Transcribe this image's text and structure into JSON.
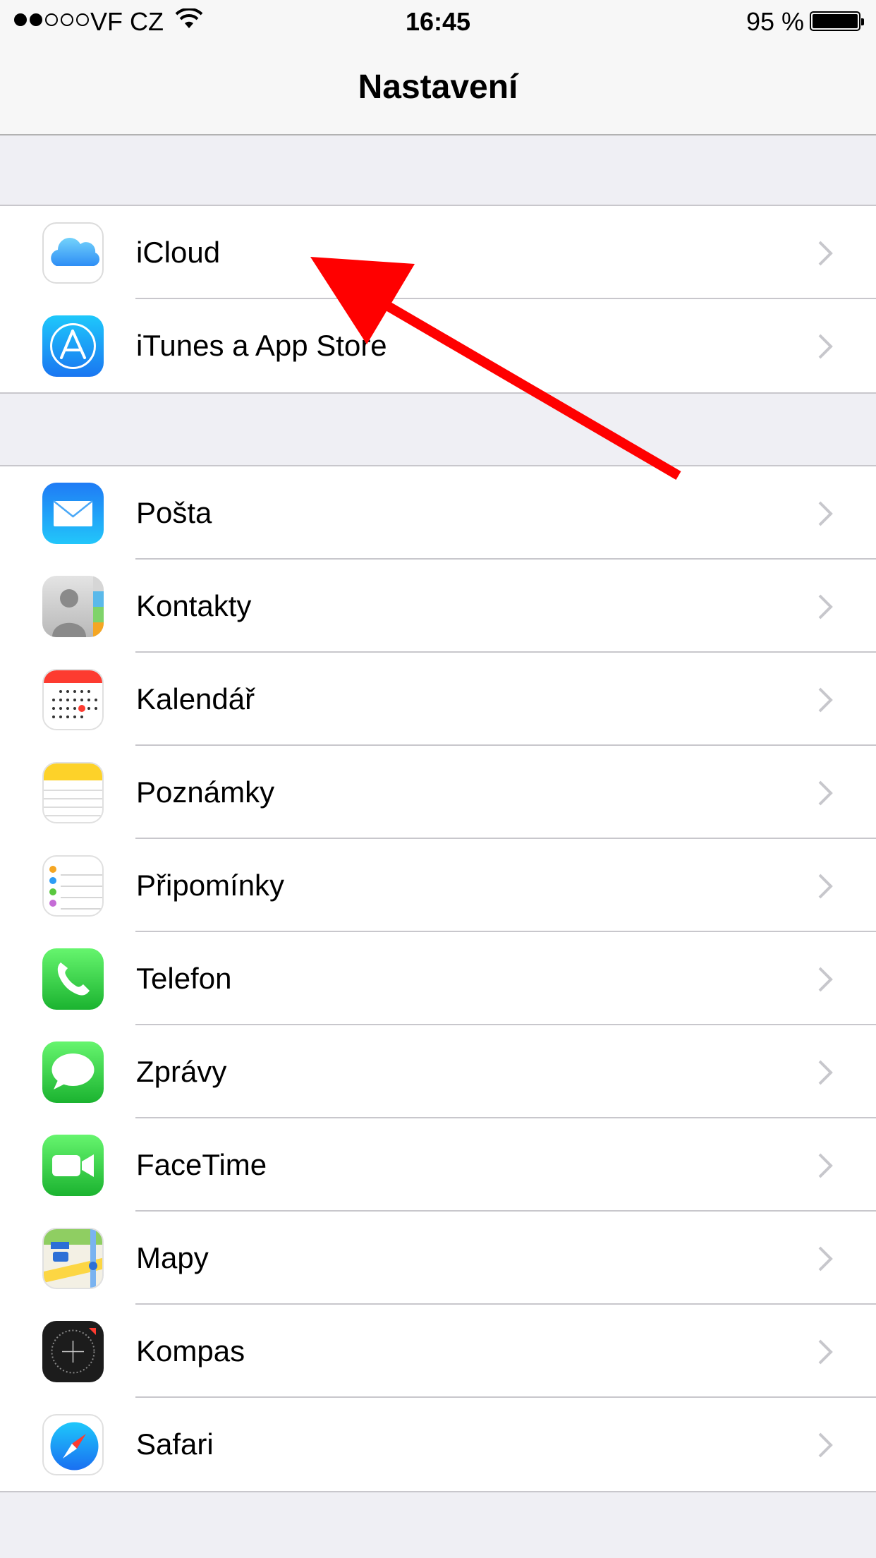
{
  "status_bar": {
    "carrier": "VF CZ",
    "time": "16:45",
    "battery_percent": "95 %",
    "signal_strength_bars": 2,
    "signal_total_bars": 5
  },
  "nav": {
    "title": "Nastavení"
  },
  "groups": [
    {
      "items": [
        {
          "label": "iCloud",
          "icon": "icloud-icon"
        },
        {
          "label": "iTunes a App Store",
          "icon": "app-store-icon"
        }
      ]
    },
    {
      "items": [
        {
          "label": "Pošta",
          "icon": "mail-icon"
        },
        {
          "label": "Kontakty",
          "icon": "contacts-icon"
        },
        {
          "label": "Kalendář",
          "icon": "calendar-icon"
        },
        {
          "label": "Poznámky",
          "icon": "notes-icon"
        },
        {
          "label": "Připomínky",
          "icon": "reminders-icon"
        },
        {
          "label": "Telefon",
          "icon": "phone-icon"
        },
        {
          "label": "Zprávy",
          "icon": "messages-icon"
        },
        {
          "label": "FaceTime",
          "icon": "facetime-icon"
        },
        {
          "label": "Mapy",
          "icon": "maps-icon"
        },
        {
          "label": "Kompas",
          "icon": "compass-icon"
        },
        {
          "label": "Safari",
          "icon": "safari-icon"
        }
      ]
    }
  ],
  "annotation": {
    "arrow_color": "#ff0000",
    "points_to": "iCloud"
  },
  "colors": {
    "group_background": "#efeff4",
    "separator": "#c8c7cc",
    "chevron": "#c7c7cc"
  }
}
